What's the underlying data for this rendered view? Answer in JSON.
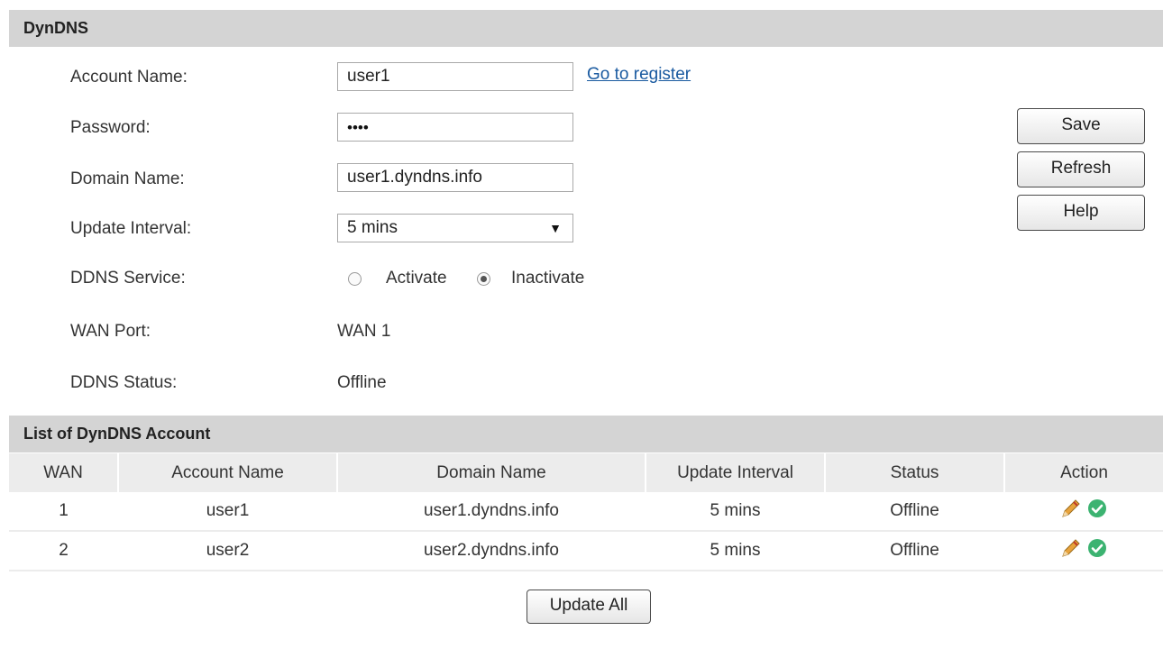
{
  "section1": {
    "title": "DynDNS"
  },
  "form": {
    "account_name_label": "Account Name:",
    "account_name_value": "user1",
    "register_link": "Go to register",
    "password_label": "Password:",
    "password_value": "••••",
    "domain_label": "Domain Name:",
    "domain_value": "user1.dyndns.info",
    "interval_label": "Update Interval:",
    "interval_value": "5 mins",
    "service_label": "DDNS Service:",
    "service_options": [
      "Activate",
      "Inactivate"
    ],
    "service_selected": "Inactivate",
    "wan_label": "WAN Port:",
    "wan_value": "WAN 1",
    "status_label": "DDNS Status:",
    "status_value": "Offline"
  },
  "buttons": {
    "save": "Save",
    "refresh": "Refresh",
    "help": "Help",
    "update_all": "Update All"
  },
  "section2": {
    "title": "List of DynDNS Account"
  },
  "table": {
    "headers": [
      "WAN",
      "Account Name",
      "Domain Name",
      "Update Interval",
      "Status",
      "Action"
    ],
    "rows": [
      [
        "1",
        "user1",
        "user1.dyndns.info",
        "5 mins",
        "Offline"
      ],
      [
        "2",
        "user2",
        "user2.dyndns.info",
        "5 mins",
        "Offline"
      ]
    ]
  },
  "icons": {
    "edit": "pencil-icon",
    "enable": "check-circle-icon"
  },
  "colors": {
    "header_bg": "#d4d4d4",
    "link": "#1a5aa0",
    "check_green": "#3cb371",
    "pencil": "#e8a33c"
  }
}
